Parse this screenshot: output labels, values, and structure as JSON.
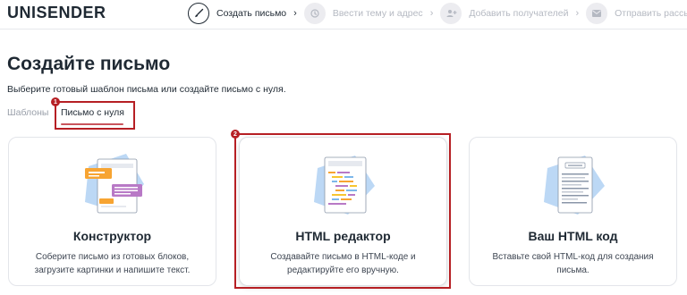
{
  "header": {
    "logo": "UNISENDER",
    "steps": [
      {
        "label": "Создать письмо",
        "state": "active",
        "icon": "brush-icon"
      },
      {
        "label": "Ввести тему и адрес",
        "state": "inactive",
        "icon": "history-icon"
      },
      {
        "label": "Добавить получателей",
        "state": "inactive",
        "icon": "add-users-icon"
      },
      {
        "label": "Отправить рассылку",
        "state": "inactive",
        "icon": "mail-icon"
      }
    ]
  },
  "main": {
    "title": "Создайте письмо",
    "subtitle": "Выберите готовый шаблон письма или создайте письмо с нуля.",
    "tabs": [
      {
        "label": "Шаблоны",
        "active": false
      },
      {
        "label": "Письмо с нуля",
        "active": true
      }
    ],
    "annotations": [
      "1",
      "2"
    ],
    "cards": [
      {
        "title": "Конструктор",
        "description": "Соберите письмо из готовых блоков, загрузите картинки и напишите текст.",
        "icon": "constructor-illustration"
      },
      {
        "title": "HTML редактор",
        "description": "Создавайте письмо в HTML-коде и редактируйте его вручную.",
        "icon": "html-editor-illustration"
      },
      {
        "title": "Ваш HTML код",
        "description": "Вставьте свой HTML-код для создания письма.",
        "icon": "html-code-illustration"
      }
    ]
  },
  "colors": {
    "accent": "#c9555c",
    "annotation": "#b61f24",
    "illustration_blue": "#bcd8f5",
    "illustration_orange": "#f7a432",
    "illustration_purple": "#b879c6"
  }
}
